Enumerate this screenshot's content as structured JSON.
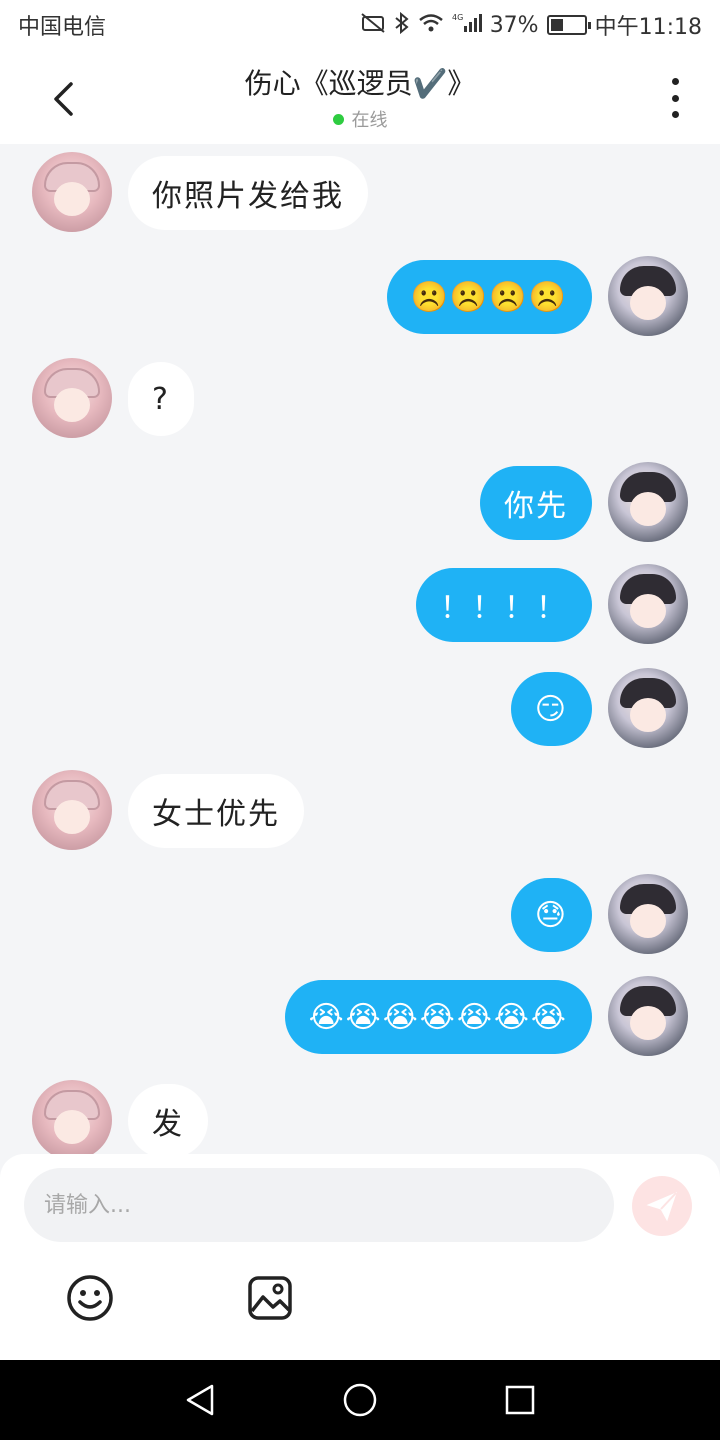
{
  "status_bar": {
    "carrier": "中国电信",
    "network": "4G",
    "battery": "37%",
    "battery_fill": 0.37,
    "time": "中午11:18"
  },
  "header": {
    "title": "伤心《巡逻员✔️》",
    "status": "在线",
    "icons": [
      "back-arrow-icon",
      "more-vert-icon"
    ]
  },
  "messages": [
    {
      "from": "other",
      "text": "你照片发给我"
    },
    {
      "from": "self",
      "text": "☹️☹️☹️☹️"
    },
    {
      "from": "other",
      "text": "?"
    },
    {
      "from": "self",
      "text": "你先"
    },
    {
      "from": "self",
      "text": "！！！！"
    },
    {
      "from": "self",
      "text": "😏"
    },
    {
      "from": "other",
      "text": "女士优先"
    },
    {
      "from": "self",
      "text": "😓"
    },
    {
      "from": "self",
      "text": "😭😭😭😭😭😭😭"
    },
    {
      "from": "other",
      "text": "发"
    }
  ],
  "input": {
    "placeholder": "请输入..."
  },
  "colors": {
    "self_bubble": "#1fb2f5",
    "other_bubble": "#ffffff",
    "background": "#f4f5f7",
    "online": "#2ecc40",
    "send_button": "#fde3e3"
  }
}
